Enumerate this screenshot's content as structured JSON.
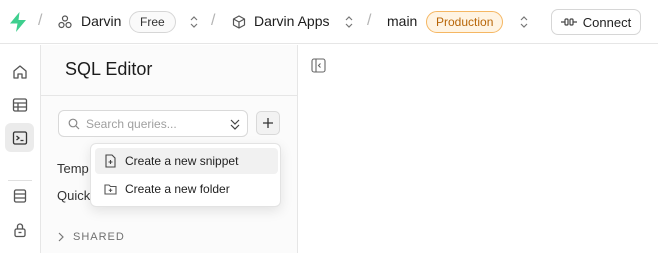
{
  "brand": {
    "accent": "#3ecf8e"
  },
  "topbar": {
    "org_name": "Darvin",
    "plan_badge": "Free",
    "project_name": "Darvin Apps",
    "branch_name": "main",
    "env_badge": "Production",
    "env_badge_color": "#f5b763",
    "connect_label": "Connect",
    "separator": "/"
  },
  "rail": {
    "items": [
      {
        "name": "home-icon",
        "active": false
      },
      {
        "name": "table-editor-icon",
        "active": false
      },
      {
        "name": "sql-editor-icon",
        "active": true
      },
      {
        "name": "database-icon",
        "active": false
      },
      {
        "name": "auth-lock-icon",
        "active": false
      }
    ]
  },
  "sql_panel": {
    "title": "SQL Editor",
    "search_placeholder": "Search queries...",
    "sections": [
      "Temp",
      "Quick"
    ],
    "shared_label": "SHARED"
  },
  "dropdown": {
    "items": [
      {
        "label": "Create a new snippet",
        "icon": "file-plus-icon",
        "highlighted": true
      },
      {
        "label": "Create a new folder",
        "icon": "folder-plus-icon",
        "highlighted": false
      }
    ]
  }
}
